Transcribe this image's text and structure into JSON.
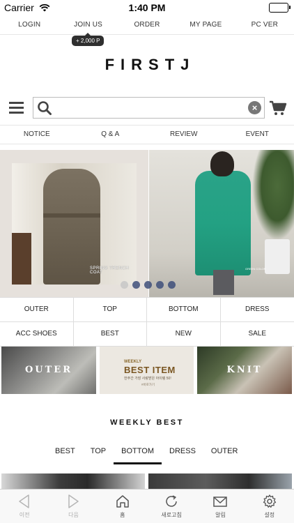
{
  "status_bar": {
    "carrier": "Carrier",
    "time": "1:40 PM"
  },
  "top_menu": {
    "items": [
      "LOGIN",
      "JOIN US",
      "ORDER",
      "MY PAGE",
      "PC VER"
    ]
  },
  "join_tooltip": "+ 2,000 P",
  "logo": "FIRSTJ",
  "search": {
    "value": "",
    "placeholder": ""
  },
  "board_menu": {
    "items": [
      "NOTICE",
      "Q & A",
      "REVIEW",
      "EVENT"
    ]
  },
  "banner": {
    "left_caption": "SPRING TRENCH COAT",
    "right_caption": "GREEN COLOR",
    "slide_count": 5,
    "active_slide": 1
  },
  "categories": [
    "OUTER",
    "TOP",
    "BOTTOM",
    "DRESS",
    "ACC SHOES",
    "BEST",
    "NEW",
    "SALE"
  ],
  "promos": {
    "outer": "OUTER",
    "best_weekly": "WEEKLY",
    "best_title": "BEST ITEM",
    "best_desc": "한주간 가장 사랑받은 아이템 50!",
    "best_link": "#바로가기",
    "knit": "KNIT"
  },
  "weekly_best": {
    "title": "WEEKLY BEST",
    "tabs": [
      "BEST",
      "TOP",
      "BOTTOM",
      "DRESS",
      "OUTER"
    ],
    "active_tab": "BOTTOM"
  },
  "tab_bar": {
    "items": [
      {
        "label": "이전",
        "icon": "back-arrow-icon",
        "enabled": false
      },
      {
        "label": "다음",
        "icon": "forward-arrow-icon",
        "enabled": false
      },
      {
        "label": "홈",
        "icon": "home-icon",
        "enabled": true
      },
      {
        "label": "새로고침",
        "icon": "refresh-icon",
        "enabled": true
      },
      {
        "label": "알림",
        "icon": "mail-icon",
        "enabled": true
      },
      {
        "label": "설정",
        "icon": "gear-icon",
        "enabled": true
      }
    ]
  }
}
